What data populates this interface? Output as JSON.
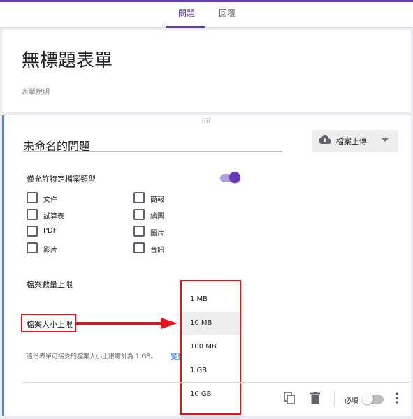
{
  "tabs": [
    {
      "label": "問題",
      "active": true
    },
    {
      "label": "回覆",
      "active": false
    }
  ],
  "form": {
    "title": "無標題表單",
    "description_placeholder": "表單說明"
  },
  "question": {
    "title": "未命名的問題",
    "type_label": "檔案上傳",
    "type_icon": "cloud-upload-icon"
  },
  "restrict": {
    "label": "僅允許特定檔案類型",
    "enabled": true,
    "types": [
      {
        "label": "文件",
        "checked": false
      },
      {
        "label": "簡報",
        "checked": false
      },
      {
        "label": "試算表",
        "checked": false
      },
      {
        "label": "繪圖",
        "checked": false
      },
      {
        "label": "PDF",
        "checked": false
      },
      {
        "label": "圖片",
        "checked": false
      },
      {
        "label": "影片",
        "checked": false
      },
      {
        "label": "音訊",
        "checked": false
      }
    ]
  },
  "max_files_label": "檔案數量上限",
  "max_size_label": "檔案大小上限",
  "size_options": [
    "1 MB",
    "10 MB",
    "100 MB",
    "1 GB",
    "10 GB"
  ],
  "selected_size": "10 MB",
  "note": "這份表單可接受的檔案大小上限總計為 1 GB。",
  "note_link": "變更",
  "footer": {
    "required_label": "必填",
    "required": false
  },
  "colors": {
    "accent": "#673ab7",
    "question_border": "#4285f4",
    "annotation_red": "#e0161d"
  }
}
